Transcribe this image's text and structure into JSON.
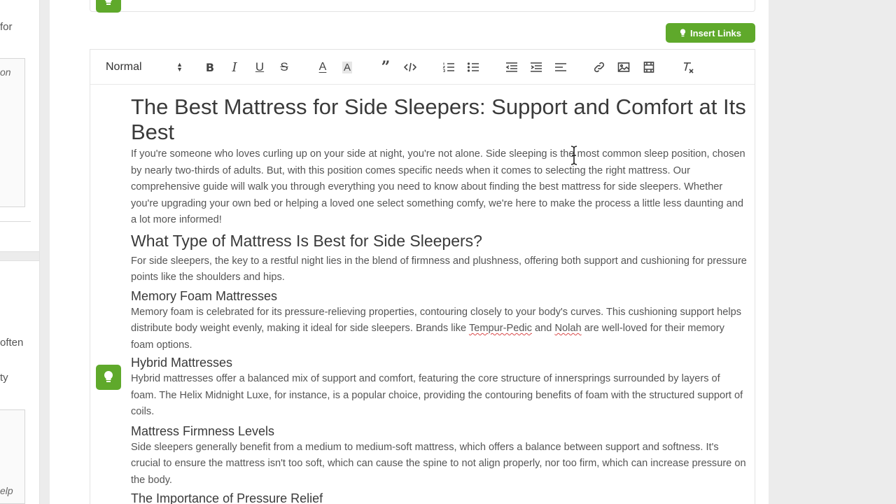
{
  "sidebar": {
    "fragments": [
      "for",
      "on",
      "often",
      "ty",
      "elp"
    ]
  },
  "editor": {
    "insert_links_label": "Insert Links",
    "format_select": "Normal",
    "toolbar_icons": [
      "bold-icon",
      "italic-icon",
      "underline-icon",
      "strike-icon",
      "font-color-icon",
      "background-color-icon",
      "blockquote-icon",
      "code-icon",
      "ordered-list-icon",
      "bullet-list-icon",
      "outdent-icon",
      "indent-icon",
      "align-icon",
      "link-icon",
      "image-icon",
      "video-icon",
      "clear-format-icon"
    ],
    "accent_color": "#5fa92b"
  },
  "article": {
    "title": "The Best Mattress for Side Sleepers: Support and Comfort at Its Best",
    "intro": "If you're someone who loves curling up on your side at night, you're not alone. Side sleeping is the most common sleep position, chosen by nearly two-thirds of adults. But, with this position comes specific needs when it comes to selecting the right mattress. Our comprehensive guide will walk you through everything you need to know about finding the best mattress for side sleepers. Whether you're upgrading your own bed or helping a loved one select something comfy, we're here to make the process a little less daunting and a lot more informed!",
    "h2_type": "What Type of Mattress Is Best for Side Sleepers?",
    "p_type": "For side sleepers, the key to a restful night lies in the blend of firmness and plushness, offering both support and cushioning for pressure points like the shoulders and hips.",
    "h3_memory": "Memory Foam Mattresses",
    "p_memory_a": "Memory foam is celebrated for its pressure-relieving properties, contouring closely to your body's curves. This cushioning support helps distribute body weight evenly, making it ideal for side sleepers. Brands like ",
    "brand_tempur": "Tempur-Pedic",
    "p_memory_b": " and ",
    "brand_nolah": "Nolah",
    "p_memory_c": " are well-loved for their memory foam options.",
    "h3_hybrid": "Hybrid Mattresses",
    "p_hybrid": "Hybrid mattresses offer a balanced mix of support and comfort, featuring the core structure of innersprings surrounded by layers of foam. The Helix Midnight Luxe, for instance, is a popular choice, providing the contouring benefits of foam with the structured support of coils.",
    "h3_firmness": "Mattress Firmness Levels",
    "p_firmness": "Side sleepers generally benefit from a medium to medium-soft mattress, which offers a balance between support and softness. It's crucial to ensure the mattress isn't too soft, which can cause the spine to not align properly, nor too firm, which can increase pressure on the body.",
    "h3_pressure": "The Importance of Pressure Relief"
  }
}
